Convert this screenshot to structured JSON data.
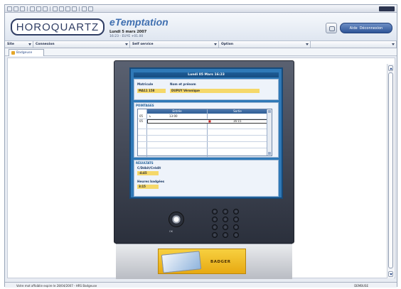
{
  "header": {
    "logo": "HOROQUARTZ",
    "brand": "eTemptation",
    "date": "Lundi 5 mars 2007",
    "time": "16:23 - EUYE +01.00",
    "help_label": "Aide",
    "logout_label": "Déconnexion"
  },
  "menubar": {
    "items": [
      "Site",
      "Connexion",
      "Self service",
      "Option",
      ""
    ]
  },
  "tabs": {
    "active": "Badgeuse"
  },
  "terminal": {
    "title": "Lundi 05 Mars 16:23",
    "matricule_label": "Matricule",
    "name_label": "Nom et prénom",
    "matricule_value": "MA11 158",
    "name_value": "DUPUY Véronique",
    "pointages_header": "POINTAGES",
    "col_entree": "Entrée",
    "col_sortie": "Sortie",
    "rows": [
      {
        "day": "05",
        "entree": "13:00",
        "sortie": ""
      },
      {
        "day": "05",
        "entree": "",
        "sortie": "16:15"
      }
    ],
    "resultats_header": "RÉSULTATS",
    "credit_label": "C/Débit/Crédit",
    "credit_value": "-4:45",
    "heures_label": "Heures badgées",
    "heures_value": "3:15",
    "nav_label": "OK",
    "badger_label": "BADGER"
  },
  "status": {
    "text": "Votre mot affaiblie expire le 28/04/2007 - HRS Badgeuse",
    "right": "DEMBUSE"
  }
}
